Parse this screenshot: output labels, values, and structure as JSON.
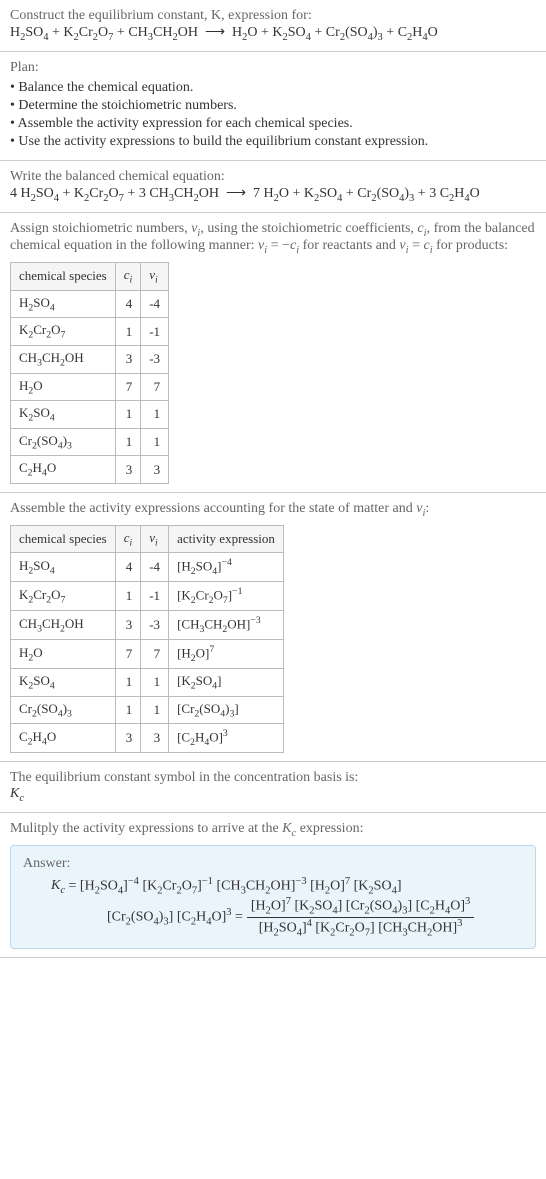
{
  "intro": {
    "prompt": "Construct the equilibrium constant, K, expression for:",
    "equation_html": "H<sub>2</sub>SO<sub>4</sub> + K<sub>2</sub>Cr<sub>2</sub>O<sub>7</sub> + CH<sub>3</sub>CH<sub>2</sub>OH &nbsp;⟶&nbsp; H<sub>2</sub>O + K<sub>2</sub>SO<sub>4</sub> + Cr<sub>2</sub>(SO<sub>4</sub>)<sub>3</sub> + C<sub>2</sub>H<sub>4</sub>O"
  },
  "plan": {
    "label": "Plan:",
    "items": [
      "• Balance the chemical equation.",
      "• Determine the stoichiometric numbers.",
      "• Assemble the activity expression for each chemical species.",
      "• Use the activity expressions to build the equilibrium constant expression."
    ]
  },
  "balanced": {
    "label": "Write the balanced chemical equation:",
    "equation_html": "4 H<sub>2</sub>SO<sub>4</sub> + K<sub>2</sub>Cr<sub>2</sub>O<sub>7</sub> + 3 CH<sub>3</sub>CH<sub>2</sub>OH &nbsp;⟶&nbsp; 7 H<sub>2</sub>O + K<sub>2</sub>SO<sub>4</sub> + Cr<sub>2</sub>(SO<sub>4</sub>)<sub>3</sub> + 3 C<sub>2</sub>H<sub>4</sub>O"
  },
  "stoich": {
    "intro_html": "Assign stoichiometric numbers, <i>ν<sub>i</sub></i>, using the stoichiometric coefficients, <i>c<sub>i</sub></i>, from the balanced chemical equation in the following manner: <i>ν<sub>i</sub></i> = −<i>c<sub>i</sub></i> for reactants and <i>ν<sub>i</sub></i> = <i>c<sub>i</sub></i> for products:",
    "headers": [
      "chemical species",
      "c_i",
      "ν_i"
    ],
    "headers_html": [
      "chemical species",
      "<i>c<sub>i</sub></i>",
      "<i>ν<sub>i</sub></i>"
    ],
    "rows": [
      {
        "species_html": "H<sub>2</sub>SO<sub>4</sub>",
        "c": 4,
        "nu": -4
      },
      {
        "species_html": "K<sub>2</sub>Cr<sub>2</sub>O<sub>7</sub>",
        "c": 1,
        "nu": -1
      },
      {
        "species_html": "CH<sub>3</sub>CH<sub>2</sub>OH",
        "c": 3,
        "nu": -3
      },
      {
        "species_html": "H<sub>2</sub>O",
        "c": 7,
        "nu": 7
      },
      {
        "species_html": "K<sub>2</sub>SO<sub>4</sub>",
        "c": 1,
        "nu": 1
      },
      {
        "species_html": "Cr<sub>2</sub>(SO<sub>4</sub>)<sub>3</sub>",
        "c": 1,
        "nu": 1
      },
      {
        "species_html": "C<sub>2</sub>H<sub>4</sub>O",
        "c": 3,
        "nu": 3
      }
    ]
  },
  "activity": {
    "intro_html": "Assemble the activity expressions accounting for the state of matter and <i>ν<sub>i</sub></i>:",
    "headers_html": [
      "chemical species",
      "<i>c<sub>i</sub></i>",
      "<i>ν<sub>i</sub></i>",
      "activity expression"
    ],
    "rows": [
      {
        "species_html": "H<sub>2</sub>SO<sub>4</sub>",
        "c": 4,
        "nu": -4,
        "act_html": "[H<sub>2</sub>SO<sub>4</sub>]<sup>−4</sup>"
      },
      {
        "species_html": "K<sub>2</sub>Cr<sub>2</sub>O<sub>7</sub>",
        "c": 1,
        "nu": -1,
        "act_html": "[K<sub>2</sub>Cr<sub>2</sub>O<sub>7</sub>]<sup>−1</sup>"
      },
      {
        "species_html": "CH<sub>3</sub>CH<sub>2</sub>OH",
        "c": 3,
        "nu": -3,
        "act_html": "[CH<sub>3</sub>CH<sub>2</sub>OH]<sup>−3</sup>"
      },
      {
        "species_html": "H<sub>2</sub>O",
        "c": 7,
        "nu": 7,
        "act_html": "[H<sub>2</sub>O]<sup>7</sup>"
      },
      {
        "species_html": "K<sub>2</sub>SO<sub>4</sub>",
        "c": 1,
        "nu": 1,
        "act_html": "[K<sub>2</sub>SO<sub>4</sub>]"
      },
      {
        "species_html": "Cr<sub>2</sub>(SO<sub>4</sub>)<sub>3</sub>",
        "c": 1,
        "nu": 1,
        "act_html": "[Cr<sub>2</sub>(SO<sub>4</sub>)<sub>3</sub>]"
      },
      {
        "species_html": "C<sub>2</sub>H<sub>4</sub>O",
        "c": 3,
        "nu": 3,
        "act_html": "[C<sub>2</sub>H<sub>4</sub>O]<sup>3</sup>"
      }
    ]
  },
  "symbol": {
    "label": "The equilibrium constant symbol in the concentration basis is:",
    "value_html": "<i>K<sub>c</sub></i>"
  },
  "result": {
    "label_html": "Mulitply the activity expressions to arrive at the <i>K<sub>c</sub></i> expression:",
    "answer_label": "Answer:",
    "expr_lhs_html": "<i>K<sub>c</sub></i> = [H<sub>2</sub>SO<sub>4</sub>]<sup>−4</sup> [K<sub>2</sub>Cr<sub>2</sub>O<sub>7</sub>]<sup>−1</sup> [CH<sub>3</sub>CH<sub>2</sub>OH]<sup>−3</sup> [H<sub>2</sub>O]<sup>7</sup> [K<sub>2</sub>SO<sub>4</sub>]",
    "expr_cont_html": "[Cr<sub>2</sub>(SO<sub>4</sub>)<sub>3</sub>] [C<sub>2</sub>H<sub>4</sub>O]<sup>3</sup> = ",
    "frac_num_html": "[H<sub>2</sub>O]<sup>7</sup> [K<sub>2</sub>SO<sub>4</sub>] [Cr<sub>2</sub>(SO<sub>4</sub>)<sub>3</sub>] [C<sub>2</sub>H<sub>4</sub>O]<sup>3</sup>",
    "frac_den_html": "[H<sub>2</sub>SO<sub>4</sub>]<sup>4</sup> [K<sub>2</sub>Cr<sub>2</sub>O<sub>7</sub>] [CH<sub>3</sub>CH<sub>2</sub>OH]<sup>3</sup>"
  }
}
